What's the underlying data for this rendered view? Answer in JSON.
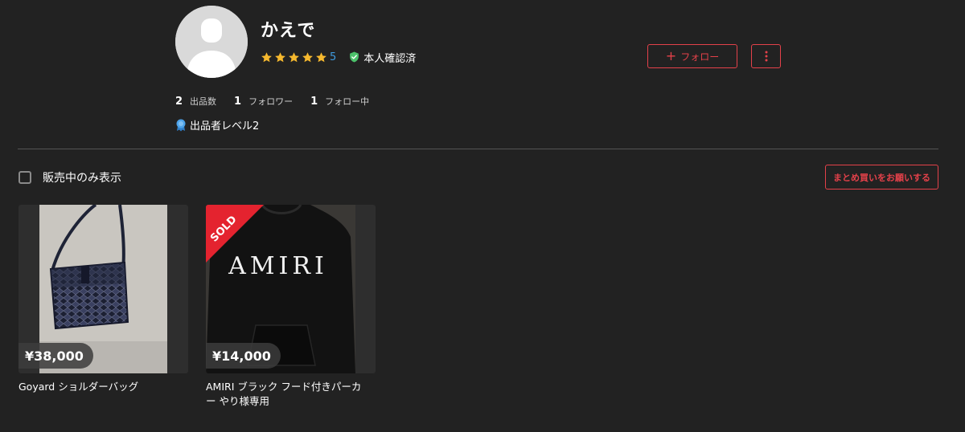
{
  "profile": {
    "username": "かえで",
    "rating_count": "5",
    "verified_label": "本人確認済",
    "follow_label": "フォロー",
    "stats": [
      {
        "num": "2",
        "label": "出品数"
      },
      {
        "num": "1",
        "label": "フォロワー"
      },
      {
        "num": "1",
        "label": "フォロー中"
      }
    ],
    "level_label": "出品者レベル2"
  },
  "filter": {
    "only_on_sale_label": "販売中のみ表示",
    "bundle_request_label": "まとめ買いをお願いする"
  },
  "items": [
    {
      "price": "¥38,000",
      "title": "Goyard ショルダーバッグ",
      "sold": false
    },
    {
      "price": "¥14,000",
      "title": "AMIRI ブラック フード付きパーカー やり様専用",
      "sold": true,
      "sold_label": "SOLD",
      "print_text": "AMIRI"
    }
  ],
  "colors": {
    "background": "#222222",
    "accent": "#e4414a",
    "star": "#f5b82e",
    "verified": "#4cc26b",
    "rating_count": "#3f9bdf"
  }
}
